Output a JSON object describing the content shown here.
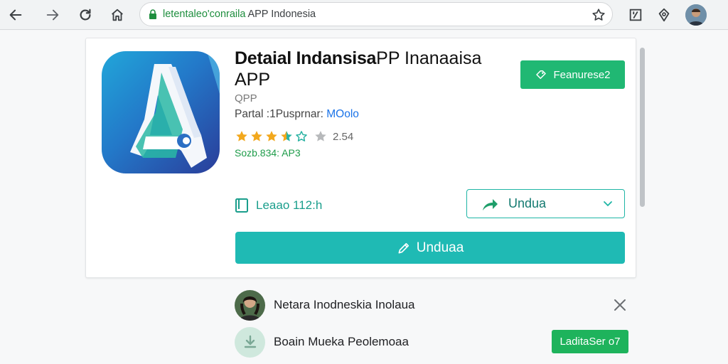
{
  "browser": {
    "url_host": "letentaleo'conraila",
    "url_rest": "APP Indonesia",
    "icons": [
      "back-icon",
      "forward-icon",
      "reload-icon",
      "home-icon",
      "lock-icon",
      "star-icon",
      "extension-icon",
      "shield-icon"
    ]
  },
  "app": {
    "title_bold": "Detaial Indansisa",
    "title_thin": "PP Inanaaisa",
    "title_line2": "APP",
    "developer": "QPP",
    "partner_label": "Partal :1Pusprnar: ",
    "partner_link": "MOolo",
    "rating": 3.5,
    "rating_value": "2.54",
    "size_text": "Sozb.834: AP3",
    "feature_button": "Feanurese2",
    "lead_text": "Leaao 112:h",
    "outline_button": "Undua",
    "primary_button": "Unduaa"
  },
  "list": [
    {
      "name": "Netara Inodneskia Inolaua"
    },
    {
      "name": "Boain Mueka Peolemoaa",
      "action": "LaditaSer o7"
    }
  ],
  "colors": {
    "green_button": "#20b873",
    "teal": "#1fbab4",
    "star_gold": "#f2a81d"
  }
}
